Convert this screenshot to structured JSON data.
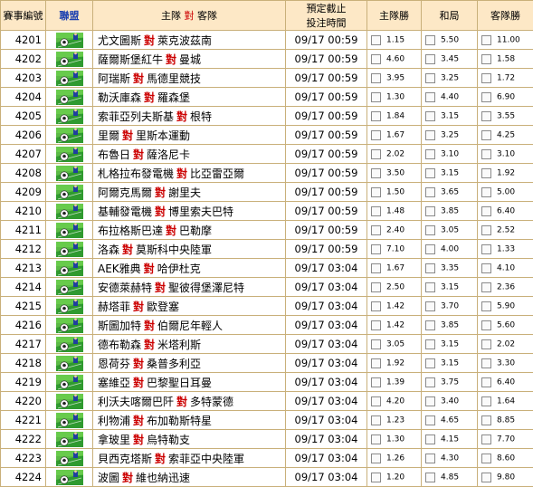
{
  "header": {
    "match_no": "賽事編號",
    "league": "聯盟",
    "home": "主隊",
    "vs": "對",
    "away": "客隊",
    "time_line1": "預定截止",
    "time_line2": "投注時間",
    "home_win": "主隊勝",
    "draw": "和局",
    "away_win": "客隊勝"
  },
  "rows": [
    {
      "no": "4201",
      "home": "尤文圖斯",
      "away": "萊克波茲南",
      "time": "09/17 00:59",
      "h": "1.15",
      "d": "5.50",
      "a": "11.00"
    },
    {
      "no": "4202",
      "home": "薩爾斯堡紅牛",
      "away": "曼城",
      "time": "09/17 00:59",
      "h": "4.60",
      "d": "3.45",
      "a": "1.58"
    },
    {
      "no": "4203",
      "home": "阿瑞斯",
      "away": "馬德里競技",
      "time": "09/17 00:59",
      "h": "3.95",
      "d": "3.25",
      "a": "1.72"
    },
    {
      "no": "4204",
      "home": "勒沃庫森",
      "away": "羅森堡",
      "time": "09/17 00:59",
      "h": "1.30",
      "d": "4.40",
      "a": "6.90"
    },
    {
      "no": "4205",
      "home": "索菲亞列夫斯基",
      "away": "根特",
      "time": "09/17 00:59",
      "h": "1.84",
      "d": "3.15",
      "a": "3.55"
    },
    {
      "no": "4206",
      "home": "里爾",
      "away": "里斯本運動",
      "time": "09/17 00:59",
      "h": "1.67",
      "d": "3.25",
      "a": "4.25"
    },
    {
      "no": "4207",
      "home": "布魯日",
      "away": "薩洛尼卡",
      "time": "09/17 00:59",
      "h": "2.02",
      "d": "3.10",
      "a": "3.10"
    },
    {
      "no": "4208",
      "home": "札格拉布發電機",
      "away": "比亞雷亞爾",
      "time": "09/17 00:59",
      "h": "3.50",
      "d": "3.15",
      "a": "1.92"
    },
    {
      "no": "4209",
      "home": "阿爾克馬爾",
      "away": "謝里夫",
      "time": "09/17 00:59",
      "h": "1.50",
      "d": "3.65",
      "a": "5.00"
    },
    {
      "no": "4210",
      "home": "基輔發電機",
      "away": "博里索夫巴特",
      "time": "09/17 00:59",
      "h": "1.48",
      "d": "3.85",
      "a": "6.40"
    },
    {
      "no": "4211",
      "home": "布拉格斯巴達",
      "away": "巴勒摩",
      "time": "09/17 00:59",
      "h": "2.40",
      "d": "3.05",
      "a": "2.52"
    },
    {
      "no": "4212",
      "home": "洛森",
      "away": "莫斯科中央陸軍",
      "time": "09/17 00:59",
      "h": "7.10",
      "d": "4.00",
      "a": "1.33"
    },
    {
      "no": "4213",
      "home": "AEK雅典",
      "away": "哈伊杜克",
      "time": "09/17 03:04",
      "h": "1.67",
      "d": "3.35",
      "a": "4.10"
    },
    {
      "no": "4214",
      "home": "安德萊赫特",
      "away": "聖彼得堡澤尼特",
      "time": "09/17 03:04",
      "h": "2.50",
      "d": "3.15",
      "a": "2.36"
    },
    {
      "no": "4215",
      "home": "赫塔菲",
      "away": "歐登塞",
      "time": "09/17 03:04",
      "h": "1.42",
      "d": "3.70",
      "a": "5.90"
    },
    {
      "no": "4216",
      "home": "斯圖加特",
      "away": "伯爾尼年輕人",
      "time": "09/17 03:04",
      "h": "1.42",
      "d": "3.85",
      "a": "5.60"
    },
    {
      "no": "4217",
      "home": "德布勒森",
      "away": "米塔利斯",
      "time": "09/17 03:04",
      "h": "3.05",
      "d": "3.15",
      "a": "2.02"
    },
    {
      "no": "4218",
      "home": "恩荷芬",
      "away": "桑普多利亞",
      "time": "09/17 03:04",
      "h": "1.92",
      "d": "3.15",
      "a": "3.30"
    },
    {
      "no": "4219",
      "home": "塞維亞",
      "away": "巴黎聖日耳曼",
      "time": "09/17 03:04",
      "h": "1.39",
      "d": "3.75",
      "a": "6.40"
    },
    {
      "no": "4220",
      "home": "利沃夫喀爾巴阡",
      "away": "多特蒙德",
      "time": "09/17 03:04",
      "h": "4.20",
      "d": "3.40",
      "a": "1.64"
    },
    {
      "no": "4221",
      "home": "利物浦",
      "away": "布加勒斯特星",
      "time": "09/17 03:04",
      "h": "1.23",
      "d": "4.65",
      "a": "8.85"
    },
    {
      "no": "4222",
      "home": "拿玻里",
      "away": "烏特勒支",
      "time": "09/17 03:04",
      "h": "1.30",
      "d": "4.15",
      "a": "7.70"
    },
    {
      "no": "4223",
      "home": "貝西克塔斯",
      "away": "索菲亞中央陸軍",
      "time": "09/17 03:04",
      "h": "1.26",
      "d": "4.30",
      "a": "8.60"
    },
    {
      "no": "4224",
      "home": "波圖",
      "away": "維也納迅速",
      "time": "09/17 03:04",
      "h": "1.20",
      "d": "4.85",
      "a": "9.80"
    }
  ]
}
